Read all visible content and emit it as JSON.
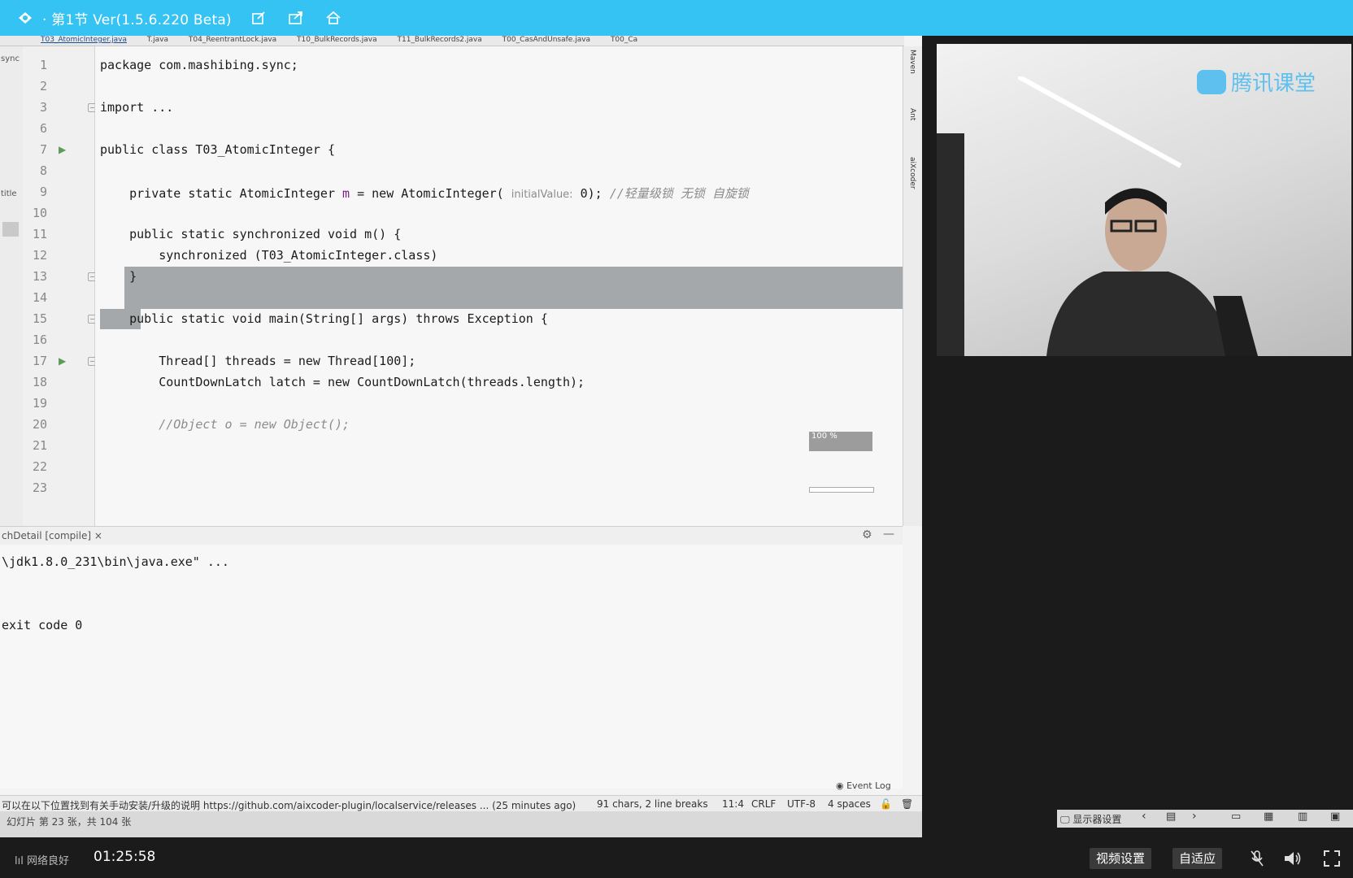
{
  "window": {
    "title": "· 第1节 Ver(1.5.6.220 Beta)"
  },
  "ide": {
    "tabs": [
      "T03_AtomicInteger.java",
      "T.java",
      "T04_ReentrantLock.java",
      "T10_BulkRecords.java",
      "T11_BulkRecords2.java",
      "T00_CasAndUnsafe.java",
      "T00_Ca"
    ],
    "left_strip_labels": [
      "sync",
      "title"
    ],
    "right_tool_labels": [
      "Maven",
      "Ant",
      "aiXcoder"
    ],
    "code_lines": [
      {
        "n": "1",
        "text": "package com.mashibing.sync;"
      },
      {
        "n": "2",
        "text": ""
      },
      {
        "n": "3",
        "text": "import ..."
      },
      {
        "n": "6",
        "text": ""
      },
      {
        "n": "7",
        "text": "public class T03_AtomicInteger {"
      },
      {
        "n": "8",
        "text": ""
      },
      {
        "n": "9",
        "pre": "    private static AtomicInteger ",
        "field": "m",
        "mid": " = new AtomicInteger( ",
        "hint": "initialValue:",
        "post": " 0); ",
        "comment": "//轻量级锁 无锁 自旋锁"
      },
      {
        "n": "10",
        "text": ""
      },
      {
        "n": "11",
        "text": "    public static synchronized void m() {"
      },
      {
        "n": "12",
        "text": "        synchronized (T03_AtomicInteger.class)"
      },
      {
        "n": "13",
        "text": "    }"
      },
      {
        "n": "14",
        "text": ""
      },
      {
        "n": "15",
        "text": "    public static void main(String[] args) throws Exception {"
      },
      {
        "n": "16",
        "text": ""
      },
      {
        "n": "17",
        "text": "        Thread[] threads = new Thread[100];"
      },
      {
        "n": "18",
        "text": "        CountDownLatch latch = new CountDownLatch(threads.length);"
      },
      {
        "n": "19",
        "text": ""
      },
      {
        "n": "20",
        "comment": "        //Object o = new Object();"
      },
      {
        "n": "21",
        "text": ""
      },
      {
        "n": "22",
        "text": ""
      },
      {
        "n": "23",
        "text": ""
      }
    ],
    "zoom_label": "100 %",
    "run_panel": {
      "title": "chDetail [compile]",
      "close": "×",
      "lines": [
        "\\jdk1.8.0_231\\bin\\java.exe\" ...",
        "",
        "",
        "exit code 0"
      ]
    },
    "event_log": "Event Log",
    "status": {
      "message": "可以在以下位置找到有关手动安装/升级的说明 https://github.com/aixcoder-plugin/localservice/releases ... (25 minutes ago)",
      "selection": "91 chars, 2 line breaks",
      "position": "11:4",
      "line_ending": "CRLF",
      "encoding": "UTF-8",
      "indent": "4 spaces"
    },
    "ppt_status": "幻灯片 第 23 张，共 104 张",
    "ppt_right_label": "显示器设置"
  },
  "webcam": {
    "logo_text": "腾讯课堂"
  },
  "player": {
    "network": "网络良好",
    "time": "01:25:58",
    "video_settings": "视频设置",
    "fit": "自适应"
  },
  "colors": {
    "titlebar": "#35c3f3",
    "selection": "#a5a8ab",
    "player_bg": "#1b1b1b"
  }
}
